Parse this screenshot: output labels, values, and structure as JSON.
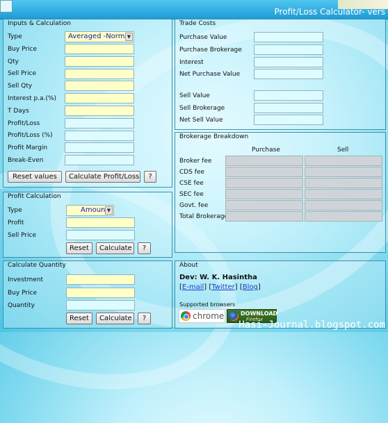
{
  "window": {
    "title": "Profit/Loss Calculator- vers"
  },
  "inputs": {
    "title": "Inputs & Calculation",
    "type_label": "Type",
    "type_value": "Averaged -Normal",
    "buy_price": "Buy Price",
    "qty": "Qty",
    "sell_price": "Sell Price",
    "sell_qty": "Sell Qty",
    "interest": "Interest p.a.(%)",
    "t_days": "T Days",
    "profit_loss": "Profit/Loss",
    "profit_loss_pct": "Profit/Loss (%)",
    "profit_margin": "Profit Margin",
    "break_even": "Break-Even",
    "reset": "Reset values",
    "calculate": "Calculate Profit/Loss",
    "help": "?"
  },
  "profit": {
    "title": "Profit Calculation",
    "type_label": "Type",
    "type_value": "Amount",
    "profit": "Profit",
    "sell_price": "Sell Price",
    "reset": "Reset",
    "calculate": "Calculate",
    "help": "?"
  },
  "quantity": {
    "title": "Calculate Quantity",
    "investment": "Investment",
    "buy_price": "Buy Price",
    "quantity": "Quantity",
    "reset": "Reset",
    "calculate": "Calculate",
    "help": "?"
  },
  "trade": {
    "title": "Trade Costs",
    "purchase_value": "Purchase Value",
    "purchase_brokerage": "Purchase Brokerage",
    "interest": "Interest",
    "net_purchase_value": "Net Purchase Value",
    "sell_value": "Sell Value",
    "sell_brokerage": "Sell Brokerage",
    "net_sell_value": "Net Sell Value"
  },
  "brokerage": {
    "title": "Brokerage Breakdown",
    "col_purchase": "Purchase",
    "col_sell": "Sell",
    "rows": [
      "Broker fee",
      "CDS fee",
      "CSE fee",
      "SEC fee",
      "Govt. fee",
      "Total Brokerage"
    ]
  },
  "about": {
    "title": "About",
    "dev": "Dev: W. K. Hasintha",
    "email": "E-mail",
    "twitter": "Twitter",
    "blog": "Blog",
    "supported": "Supported browsers",
    "chrome": "chrome",
    "firefox_top": "DOWNLOAD",
    "firefox_bottom": "Firefox"
  },
  "watermark": "Hasi-Journal.blogspot.com"
}
